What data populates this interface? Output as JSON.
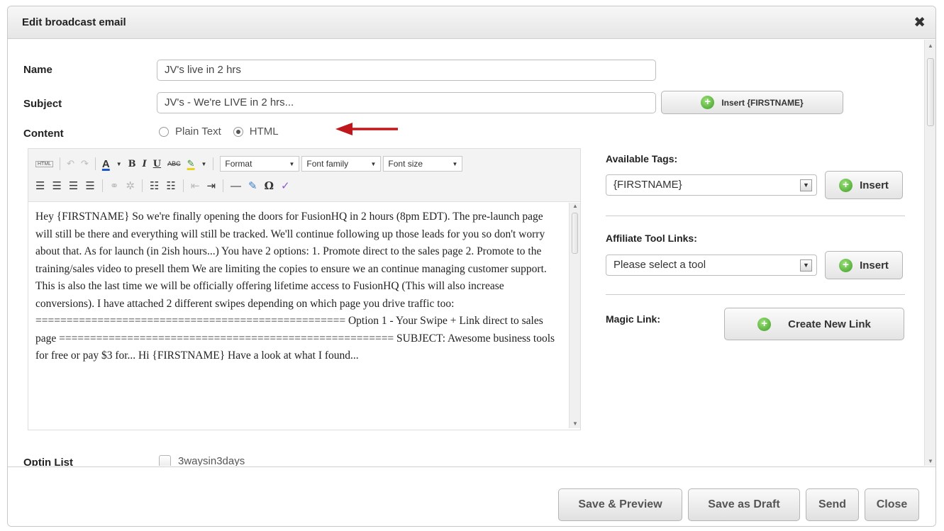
{
  "dialog": {
    "title": "Edit broadcast email",
    "close_glyph": "✖"
  },
  "form": {
    "name_label": "Name",
    "name_value": "JV's live in 2 hrs",
    "subject_label": "Subject",
    "subject_value": "JV's - We're LIVE in 2 hrs...",
    "insert_firstname_label": "Insert {FIRSTNAME}",
    "content_label": "Content",
    "content_options": [
      "Plain Text",
      "HTML"
    ],
    "content_selected": "HTML",
    "optin_label": "Optin List",
    "optin_item": "3waysin3days"
  },
  "editor": {
    "html_button": "HTML",
    "format_select": "Format",
    "font_family_select": "Font family",
    "font_size_select": "Font size",
    "body_text": "Hey {FIRSTNAME} So we're finally opening the doors for FusionHQ in 2 hours (8pm EDT). The pre-launch page will still be there and everything will still be tracked. We'll continue following up those leads for you so don't worry about that. As for launch (in 2ish hours...) You have 2 options: 1. Promote direct to the sales page 2. Promote to the training/sales video to presell them We are limiting the copies to ensure we an continue managing customer support. This is also the last time we will be officially offering lifetime access to FusionHQ (This will also increase conversions). I have attached 2 different swipes depending on which page you drive traffic too: ================================================== Option 1 - Your Swipe + Link direct to sales page ====================================================== SUBJECT: Awesome business tools for free or pay $3 for... Hi {FIRSTNAME} Have a look at what I found..."
  },
  "sidebar": {
    "available_tags_label": "Available Tags:",
    "available_tags_value": "{FIRSTNAME}",
    "insert_label": "Insert",
    "affiliate_label": "Affiliate Tool Links:",
    "affiliate_value": "Please select a tool",
    "affiliate_insert_label": "Insert",
    "magic_link_label": "Magic Link:",
    "create_link_label": "Create New Link"
  },
  "footer": {
    "save_preview": "Save & Preview",
    "save_draft": "Save as Draft",
    "send": "Send",
    "close": "Close"
  },
  "colors": {
    "annotation_arrow": "#c0171c",
    "plus_green": "#3e9e24"
  }
}
